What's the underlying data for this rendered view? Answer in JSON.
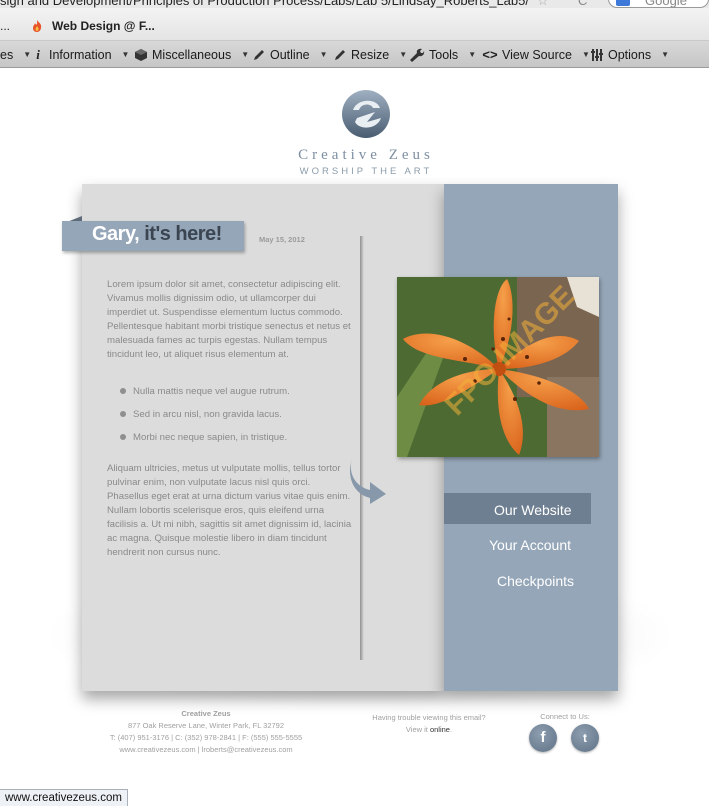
{
  "browser": {
    "url_fragment": "sign and Development/Principles of Production Process/Labs/Lab 5/Lindsay_Roberts_Lab5/",
    "search_engine_label": "Google",
    "bookmark_ellipsis": "...",
    "bookmark_label": "Web Design @ F..."
  },
  "devbar": {
    "items": [
      {
        "label": "es",
        "icon": ""
      },
      {
        "label": "Information",
        "icon": "info-icon"
      },
      {
        "label": "Miscellaneous",
        "icon": "cube-icon"
      },
      {
        "label": "Outline",
        "icon": "pencil-icon"
      },
      {
        "label": "Resize",
        "icon": "resize-pencil-icon"
      },
      {
        "label": "Tools",
        "icon": "wrench-icon"
      },
      {
        "label": "View Source",
        "icon": "code-icon"
      },
      {
        "label": "Options",
        "icon": "sliders-icon"
      }
    ]
  },
  "brand": {
    "name": "Creative Zeus",
    "tagline": "WORSHIP THE ART"
  },
  "article": {
    "title_highlight": "Gary,",
    "title_rest": " it's here!",
    "date": "May 15, 2012",
    "paragraph1": "Lorem ipsum dolor sit amet, consectetur adipiscing elit. Vivamus mollis dignissim odio, ut ullamcorper dui imperdiet ut. Suspendisse elementum luctus commodo. Pellentesque habitant morbi tristique senectus et netus et malesuada fames ac turpis egestas. Nullam tempus tincidunt leo, ut aliquet risus elementum at.",
    "bullets": [
      "Nulla mattis neque vel augue rutrum.",
      "Sed in arcu nisl, non gravida lacus.",
      "Morbi nec neque sapien, in tristique."
    ],
    "paragraph2": "Aliquam ultricies, metus ut vulputate mollis, tellus tortor pulvinar enim, non vulputate lacus nisl quis orci. Phasellus eget erat at urna dictum varius vitae quis enim. Nullam lobortis scelerisque eros, quis eleifend urna facilisis a. Ut mi nibh, sagittis sit amet dignissim id, lacinia ac magna. Quisque molestie libero in diam tincidunt hendrerit non cursus nunc."
  },
  "photo": {
    "watermark": "FPO IMAGE"
  },
  "nav": {
    "items": [
      "Our Website",
      "Your Account",
      "Checkpoints"
    ],
    "active_index": 0
  },
  "footer": {
    "company": "Creative Zeus",
    "address": "877 Oak Reserve Lane, Winter Park, FL 32792",
    "phones": "T: (407) 951-3176 | C: (352) 978-2841 | F: (555) 555-5555",
    "web_email": "www.creativezeus.com | lroberts@creativezeus.com",
    "trouble_text": "Having trouble viewing this email?",
    "view_it": "View it ",
    "online_link": "online",
    "period": ".",
    "connect_label": "Connect to Us:",
    "facebook_glyph": "f",
    "twitter_glyph": "t"
  },
  "status_bar": {
    "text": "www.creativezeus.com"
  },
  "colors": {
    "panel_left": "#dcdcdc",
    "panel_right": "#95a6b8",
    "nav_active": "#6f7f92",
    "ribbon": "#95a6b8",
    "brand_text": "#7d8ea1"
  }
}
